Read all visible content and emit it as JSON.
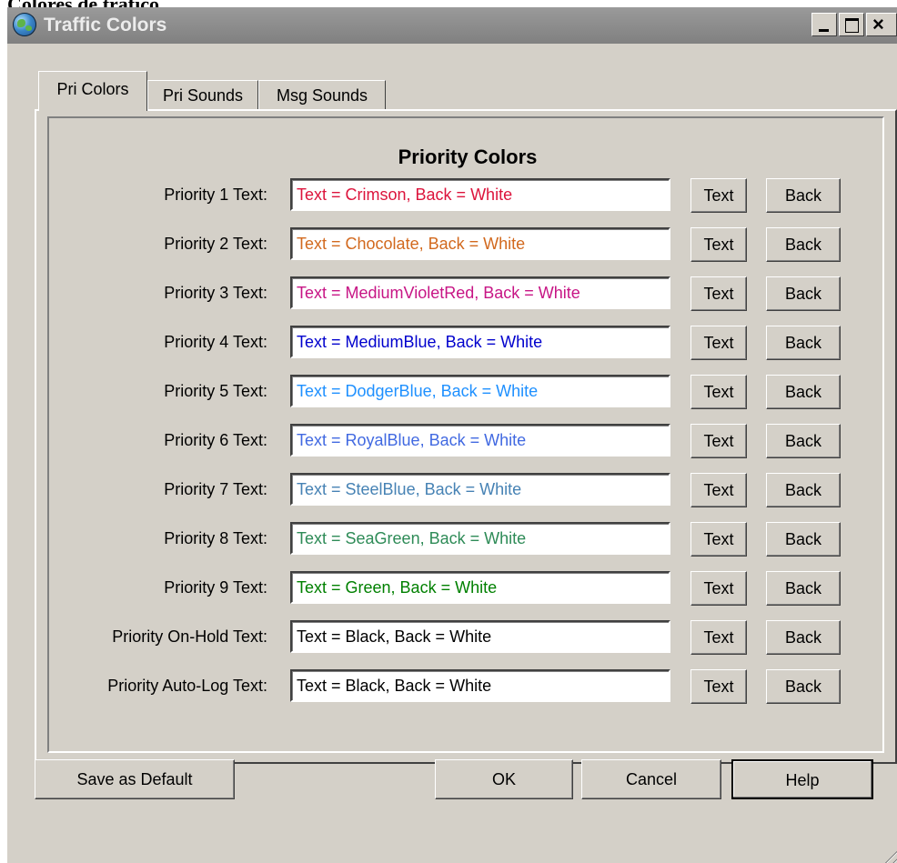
{
  "caption": "Colores de tráfico.",
  "window": {
    "title": "Traffic Colors",
    "minimize_glyph": "_",
    "close_glyph": "×"
  },
  "tabs": [
    {
      "label": "Pri Colors",
      "active": true
    },
    {
      "label": "Pri Sounds",
      "active": false
    },
    {
      "label": "Msg Sounds",
      "active": false
    }
  ],
  "panel": {
    "title": "Priority Colors",
    "rows": [
      {
        "label": "Priority 1 Text:",
        "value": "Text = Crimson, Back = White",
        "color": "#dc143c",
        "text_button": "Text",
        "back_button": "Back"
      },
      {
        "label": "Priority 2 Text:",
        "value": "Text = Chocolate, Back = White",
        "color": "#d2691e",
        "text_button": "Text",
        "back_button": "Back"
      },
      {
        "label": "Priority 3 Text:",
        "value": "Text = MediumVioletRed, Back = White",
        "color": "#c71585",
        "text_button": "Text",
        "back_button": "Back"
      },
      {
        "label": "Priority 4 Text:",
        "value": "Text = MediumBlue, Back = White",
        "color": "#0000cd",
        "text_button": "Text",
        "back_button": "Back"
      },
      {
        "label": "Priority 5 Text:",
        "value": "Text = DodgerBlue, Back = White",
        "color": "#1e90ff",
        "text_button": "Text",
        "back_button": "Back"
      },
      {
        "label": "Priority 6 Text:",
        "value": "Text = RoyalBlue, Back = White",
        "color": "#4169e1",
        "text_button": "Text",
        "back_button": "Back"
      },
      {
        "label": "Priority 7 Text:",
        "value": "Text = SteelBlue, Back = White",
        "color": "#4682b4",
        "text_button": "Text",
        "back_button": "Back"
      },
      {
        "label": "Priority 8 Text:",
        "value": "Text = SeaGreen, Back = White",
        "color": "#2e8b57",
        "text_button": "Text",
        "back_button": "Back"
      },
      {
        "label": "Priority 9 Text:",
        "value": "Text = Green, Back = White",
        "color": "#008000",
        "text_button": "Text",
        "back_button": "Back"
      },
      {
        "label": "Priority On-Hold Text:",
        "value": "Text = Black, Back = White",
        "color": "#000000",
        "text_button": "Text",
        "back_button": "Back"
      },
      {
        "label": "Priority Auto-Log Text:",
        "value": "Text = Black, Back = White",
        "color": "#000000",
        "text_button": "Text",
        "back_button": "Back"
      }
    ]
  },
  "footer": {
    "save_default": "Save as Default",
    "ok": "OK",
    "cancel": "Cancel",
    "help": "Help"
  }
}
